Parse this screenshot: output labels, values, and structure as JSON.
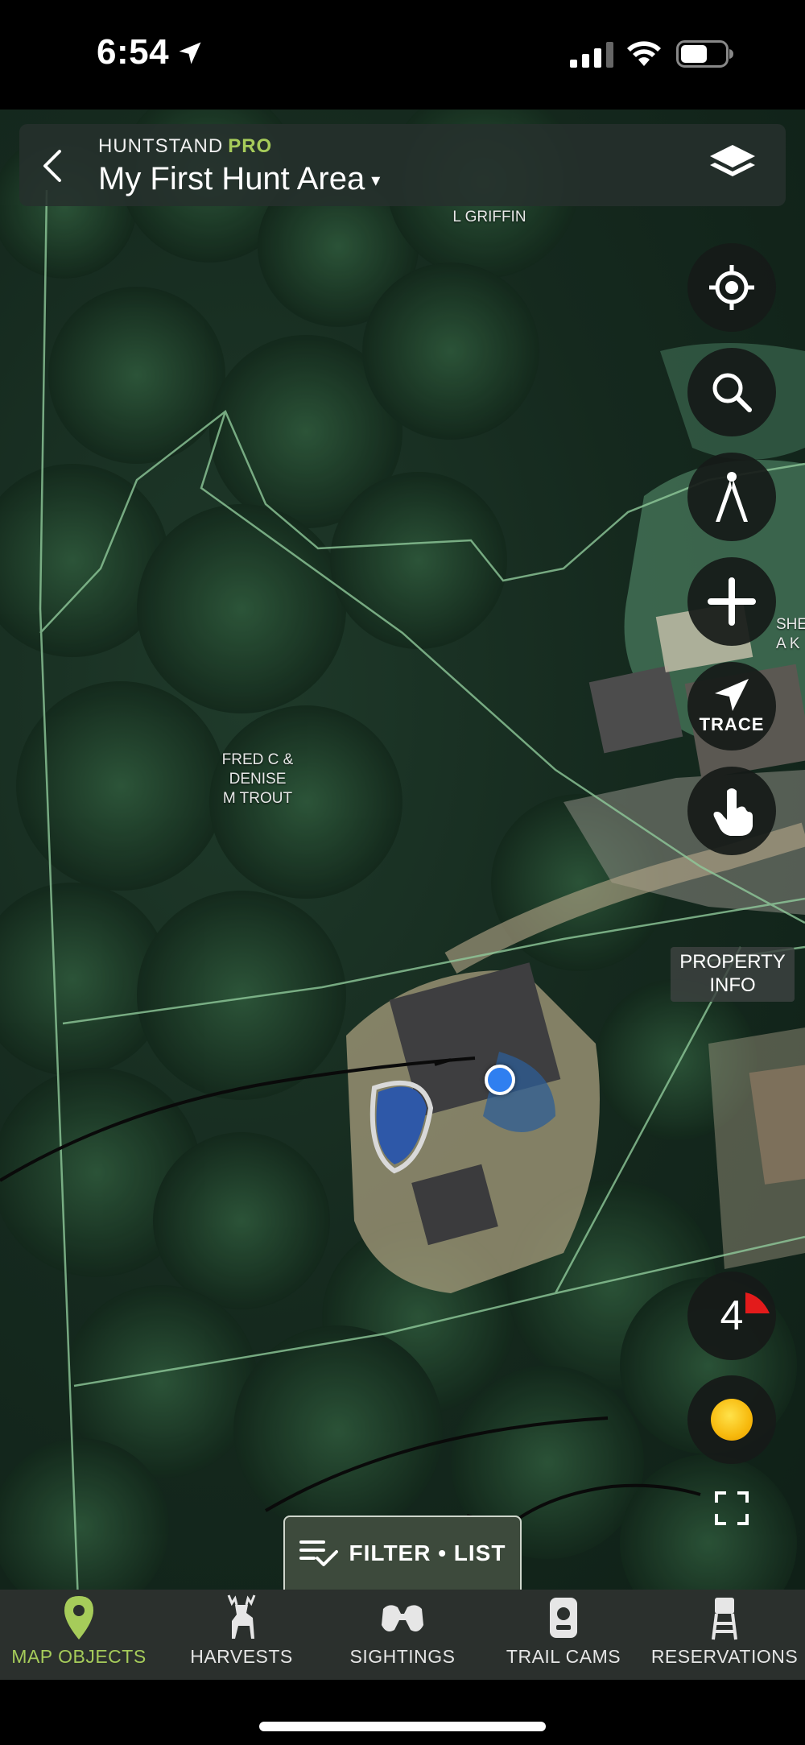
{
  "status_bar": {
    "time": "6:54"
  },
  "header": {
    "brand": "HUNTSTAND",
    "brand_tier": "PRO",
    "title": "My First Hunt Area",
    "title_caret": "▾"
  },
  "map": {
    "labels": {
      "griffin": "L GRIFFIN",
      "trout_line1": "FRED C &",
      "trout_line2": "DENISE",
      "trout_line3": "M TROUT",
      "edge_line1": "SHE",
      "edge_line2": "A K"
    },
    "colors": {
      "property_lines": "#8fc99a",
      "accent": "#a6cc5a"
    }
  },
  "controls": {
    "trace_label": "TRACE",
    "property_info_line1": "PROPERTY",
    "property_info_line2": "INFO",
    "wind_speed": "4",
    "filter_label": "FILTER • LIST"
  },
  "tabs": [
    {
      "label": "MAP OBJECTS",
      "icon": "map-pin-icon",
      "active": true
    },
    {
      "label": "HARVESTS",
      "icon": "deer-icon",
      "active": false
    },
    {
      "label": "SIGHTINGS",
      "icon": "binoculars-icon",
      "active": false
    },
    {
      "label": "TRAIL CAMS",
      "icon": "trail-camera-icon",
      "active": false
    },
    {
      "label": "RESERVATIONS",
      "icon": "tree-stand-icon",
      "active": false
    }
  ]
}
